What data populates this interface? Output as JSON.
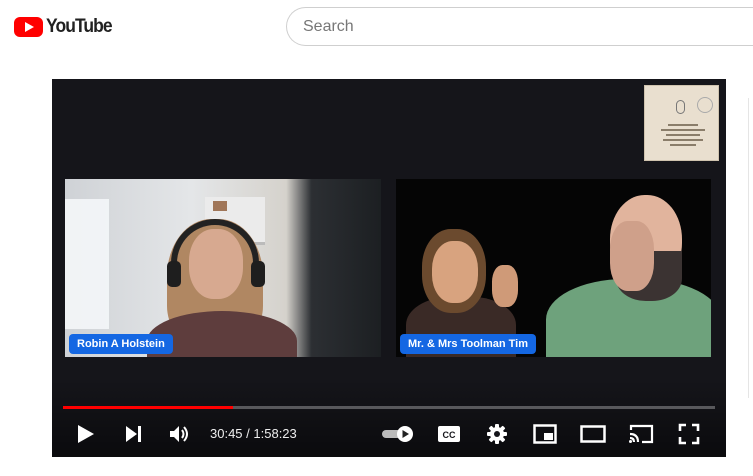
{
  "header": {
    "logo_text": "YouTube",
    "search_placeholder": "Search"
  },
  "player": {
    "channel_badge": "HOLSTEIN HOUSE PODCAST",
    "participants": [
      {
        "name": "Robin A Holstein"
      },
      {
        "name": "Mr. & Mrs Toolman Tim"
      }
    ],
    "current_time": "30:45",
    "duration": "1:58:23",
    "progress_fraction": 0.26,
    "colors": {
      "progress": "#ff0000",
      "name_tag": "#1467e3",
      "brand": "#ff0000"
    },
    "controls": [
      "play-icon",
      "next-icon",
      "volume-icon",
      "autoplay-toggle-icon",
      "captions-icon",
      "settings-icon",
      "miniplayer-icon",
      "theater-icon",
      "cast-icon",
      "fullscreen-icon"
    ]
  }
}
